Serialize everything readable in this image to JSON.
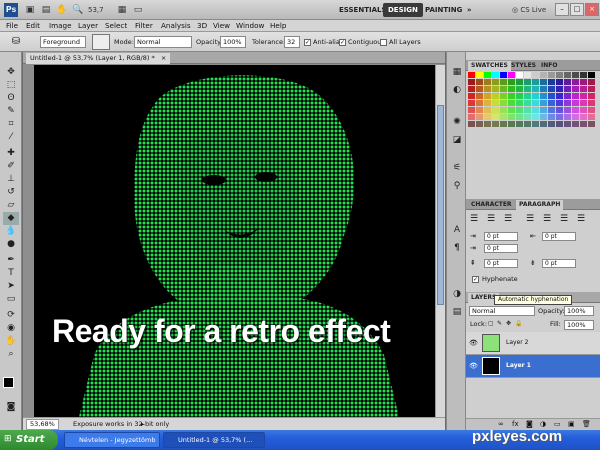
{
  "topbar": {
    "app_icon": "Ps",
    "zoom": "53,7",
    "workspaces": [
      "ESSENTIALS",
      "DESIGN",
      "PAINTING"
    ],
    "cs_live": "CS Live",
    "more": "»",
    "minimize": "–",
    "maximize": "□",
    "close": "×"
  },
  "menu": [
    "File",
    "Edit",
    "Image",
    "Layer",
    "Select",
    "Filter",
    "Analysis",
    "3D",
    "View",
    "Window",
    "Help"
  ],
  "options": {
    "fill_source": "Foreground",
    "mode_label": "Mode:",
    "mode_value": "Normal",
    "opacity_label": "Opacity:",
    "opacity_value": "100%",
    "tolerance_label": "Tolerance:",
    "tolerance_value": "32",
    "anti_alias": "Anti-alias",
    "contiguous": "Contiguous",
    "all_layers": "All Layers"
  },
  "document": {
    "tab_title": "Untitled-1 @ 53,7% (Layer 1, RGB/8) *",
    "tab_close": "×",
    "overlay_text": "Ready for a retro effect",
    "zoom_status": "53,68%",
    "status_text": "Exposure works in 32-bit only"
  },
  "swatches": {
    "tabs": [
      "SWATCHES",
      "STYLES",
      "INFO"
    ]
  },
  "character": {
    "tabs": [
      "CHARACTER",
      "PARAGRAPH"
    ],
    "indent_left": "0 pt",
    "indent_right": "0 pt",
    "first_line": "0 pt",
    "space_before": "0 pt",
    "space_after": "0 pt",
    "hyphenate": "Hyphenate"
  },
  "layers": {
    "tab": "LAYERS",
    "tooltip": "Automatic hyphenation",
    "blend": "Normal",
    "opacity_label": "Opacity:",
    "opacity_value": "100%",
    "lock_label": "Lock:",
    "fill_label": "Fill:",
    "fill_value": "100%",
    "items": [
      {
        "name": "Layer 2"
      },
      {
        "name": "Layer 1"
      }
    ]
  },
  "taskbar": {
    "start": "Start",
    "tasks": [
      "Névtelen - Jegyzettömb",
      "Untitled-1 @ 53,7% (..."
    ]
  },
  "watermark": "pxleyes.com",
  "colors": {
    "halftone_green": "#22e050",
    "selected_layer": "#3a6fd0",
    "design_workspace": "#3a3a3a"
  }
}
